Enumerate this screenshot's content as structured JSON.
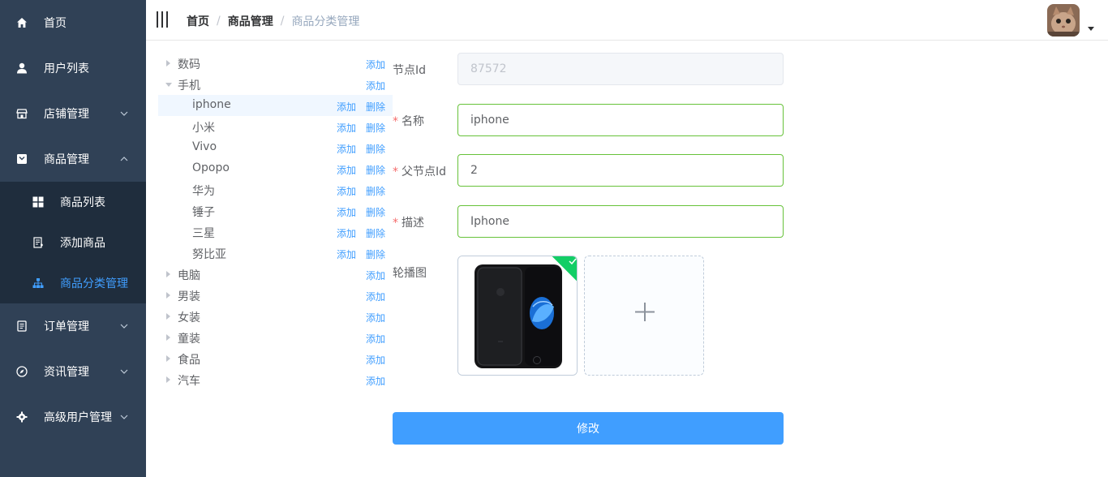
{
  "sidebar": {
    "items": [
      {
        "label": "首页",
        "icon": "home-icon"
      },
      {
        "label": "用户列表",
        "icon": "user-icon"
      },
      {
        "label": "店铺管理",
        "icon": "shop-icon"
      },
      {
        "label": "商品管理",
        "icon": "goods-icon"
      },
      {
        "label": "订单管理",
        "icon": "order-icon"
      },
      {
        "label": "资讯管理",
        "icon": "compass-icon"
      },
      {
        "label": "高级用户管理",
        "icon": "gear-icon"
      }
    ],
    "sub_items": [
      {
        "label": "商品列表",
        "icon": "grid-icon"
      },
      {
        "label": "添加商品",
        "icon": "document-add-icon"
      },
      {
        "label": "商品分类管理",
        "icon": "tree-icon"
      }
    ],
    "colors": {
      "bg": "#304156",
      "sub_bg": "#1f2d3d",
      "active": "#409eff"
    }
  },
  "header": {
    "breadcrumb": [
      "首页",
      "商品管理",
      "商品分类管理"
    ],
    "separator": "/"
  },
  "tree": {
    "nodes": [
      {
        "label": "数码",
        "add": "添加"
      },
      {
        "label": "手机",
        "add": "添加"
      },
      {
        "label": "iphone",
        "add": "添加",
        "delete": "删除"
      },
      {
        "label": "小米",
        "add": "添加",
        "delete": "删除"
      },
      {
        "label": "Vivo",
        "add": "添加",
        "delete": "删除"
      },
      {
        "label": "Opopo",
        "add": "添加",
        "delete": "删除"
      },
      {
        "label": "华为",
        "add": "添加",
        "delete": "删除"
      },
      {
        "label": "锤子",
        "add": "添加",
        "delete": "删除"
      },
      {
        "label": "三星",
        "add": "添加",
        "delete": "删除"
      },
      {
        "label": "努比亚",
        "add": "添加",
        "delete": "删除"
      },
      {
        "label": "电脑",
        "add": "添加"
      },
      {
        "label": "男装",
        "add": "添加"
      },
      {
        "label": "女装",
        "add": "添加"
      },
      {
        "label": "童装",
        "add": "添加"
      },
      {
        "label": "食品",
        "add": "添加"
      },
      {
        "label": "汽车",
        "add": "添加"
      }
    ]
  },
  "form": {
    "node_id": {
      "label": "节点Id",
      "value": "87572"
    },
    "name": {
      "label": "名称",
      "value": "iphone",
      "required": "*"
    },
    "parent_id": {
      "label": "父节点Id",
      "value": "2",
      "required": "*"
    },
    "desc": {
      "label": "描述",
      "value": "Iphone",
      "required": "*"
    },
    "carousel": {
      "label": "轮播图"
    },
    "submit_label": "修改"
  }
}
